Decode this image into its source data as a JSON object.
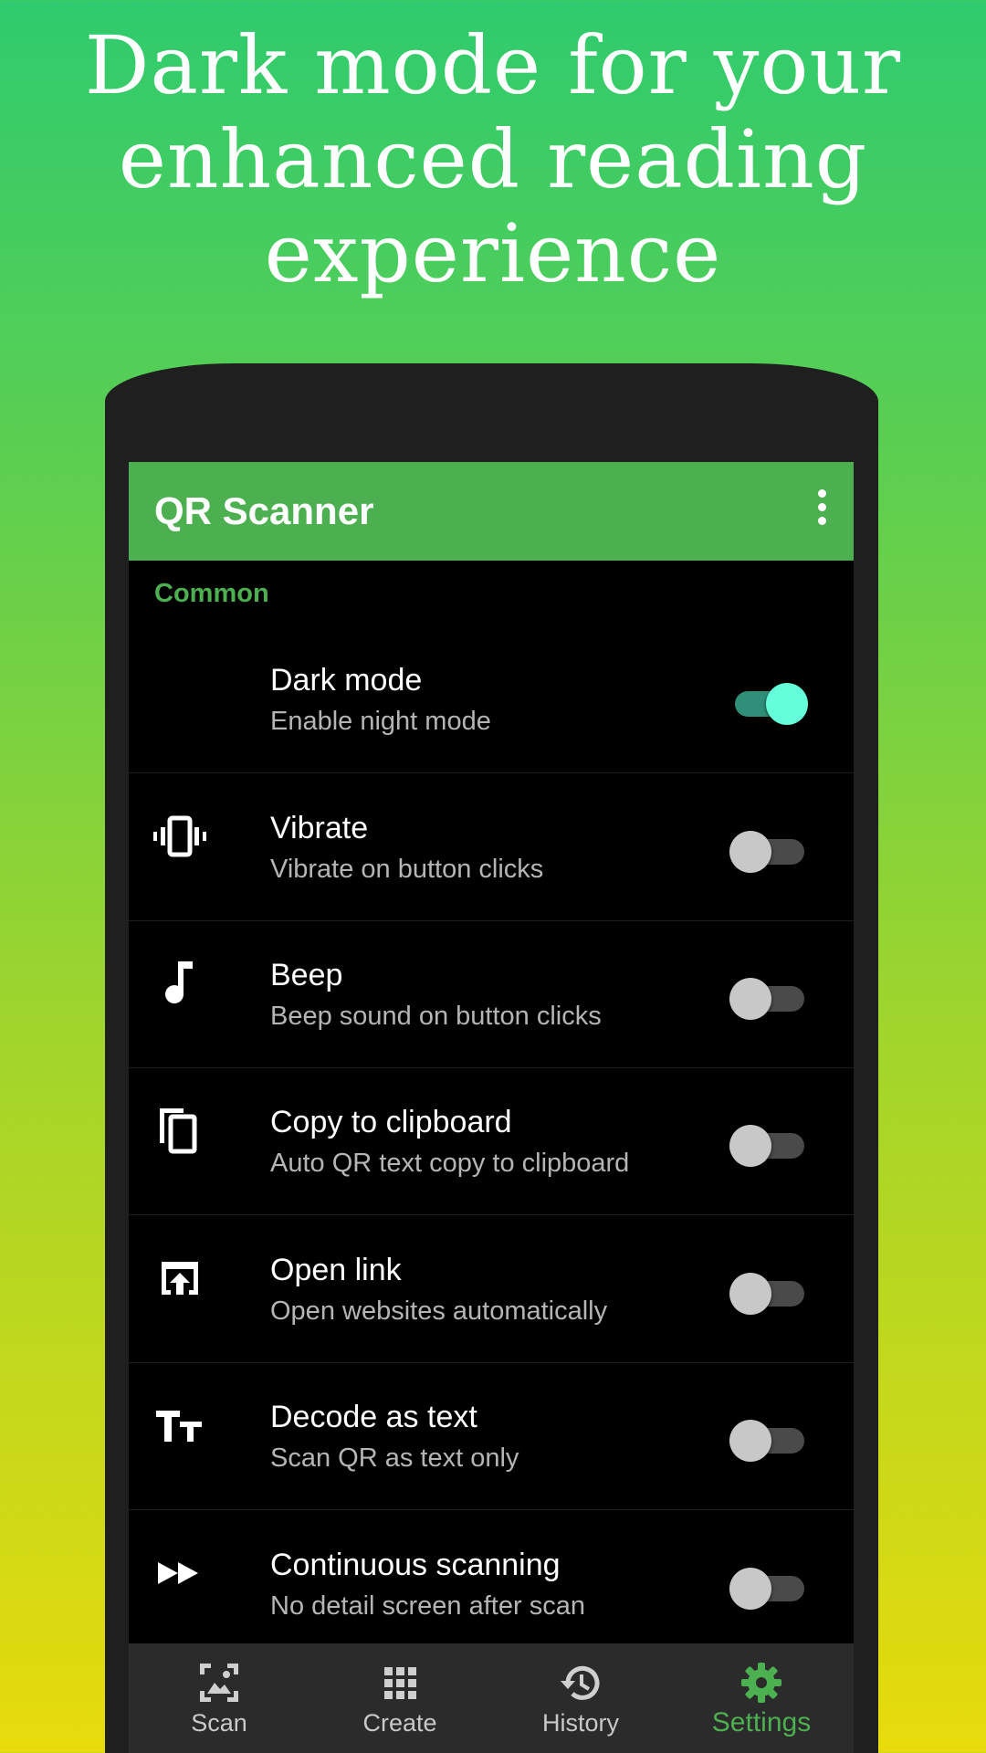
{
  "headline": [
    "Dark mode for your",
    "enhanced reading",
    "experience"
  ],
  "app": {
    "title": "QR Scanner",
    "accent_color": "#4caf50",
    "toggle_on_color": "#64ffda"
  },
  "section": {
    "title": "Common"
  },
  "settings": [
    {
      "icon": "moon-icon",
      "title": "Dark mode",
      "subtitle": "Enable night mode",
      "enabled": true
    },
    {
      "icon": "vibrate-icon",
      "title": "Vibrate",
      "subtitle": "Vibrate on button clicks",
      "enabled": false
    },
    {
      "icon": "music-note-icon",
      "title": "Beep",
      "subtitle": "Beep sound on button clicks",
      "enabled": false
    },
    {
      "icon": "copy-icon",
      "title": "Copy to clipboard",
      "subtitle": "Auto QR text copy to clipboard",
      "enabled": false
    },
    {
      "icon": "open-in-browser-icon",
      "title": "Open link",
      "subtitle": "Open websites automatically",
      "enabled": false
    },
    {
      "icon": "text-fields-icon",
      "title": "Decode as text",
      "subtitle": "Scan QR as text only",
      "enabled": false
    },
    {
      "icon": "fast-forward-icon",
      "title": "Continuous scanning",
      "subtitle": "No detail screen after scan",
      "enabled": false
    }
  ],
  "nav": [
    {
      "icon": "image-scan-icon",
      "label": "Scan",
      "active": false
    },
    {
      "icon": "grid-icon",
      "label": "Create",
      "active": false
    },
    {
      "icon": "history-icon",
      "label": "History",
      "active": false
    },
    {
      "icon": "gear-icon",
      "label": "Settings",
      "active": true
    }
  ]
}
